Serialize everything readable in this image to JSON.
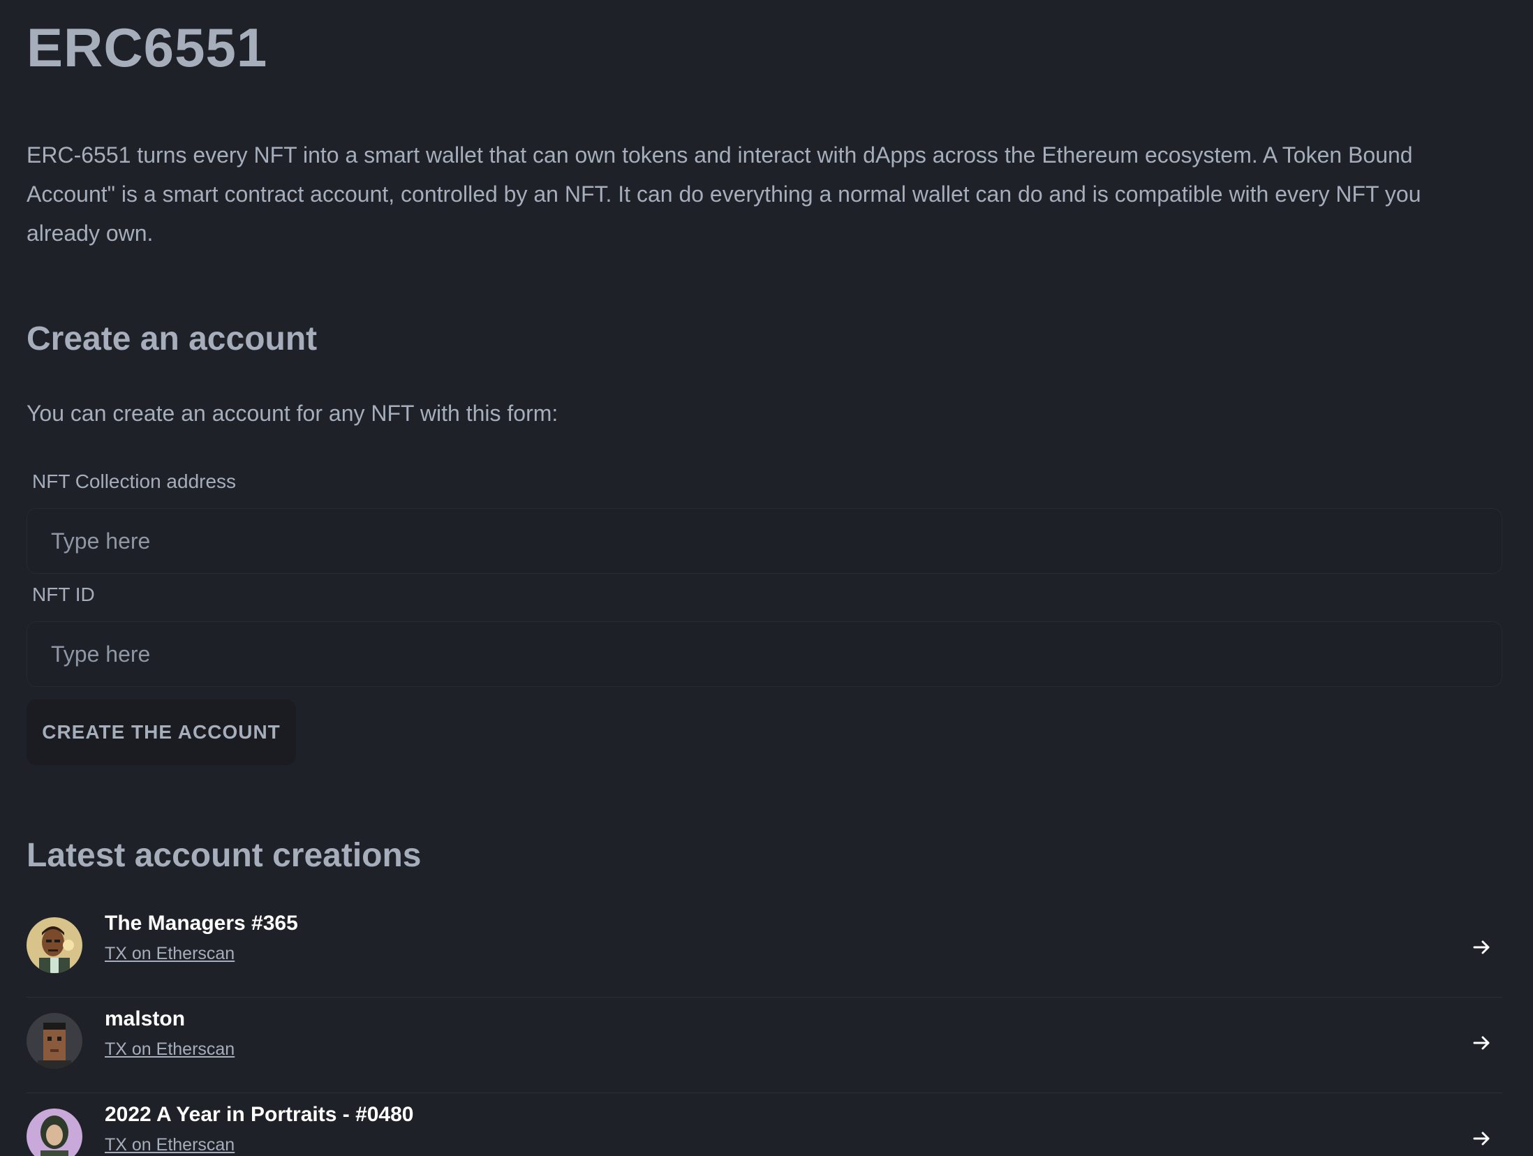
{
  "header": {
    "title": "ERC6551",
    "intro": "ERC-6551 turns every NFT into a smart wallet that can own tokens and interact with dApps across the Ethereum ecosystem. A Token Bound Account\" is a smart contract account, controlled by an NFT. It can do everything a normal wallet can do and is compatible with every NFT you already own."
  },
  "create": {
    "heading": "Create an account",
    "subtitle": "You can create an account for any NFT with this form:",
    "collection_label": "NFT Collection address",
    "collection_placeholder": "Type here",
    "id_label": "NFT ID",
    "id_placeholder": "Type here",
    "button_label": "CREATE THE ACCOUNT"
  },
  "latest": {
    "heading": "Latest account creations",
    "items": [
      {
        "title": "The Managers #365",
        "link": "TX on Etherscan",
        "icon": "arrow-right-icon"
      },
      {
        "title": "malston",
        "link": "TX on Etherscan",
        "icon": "arrow-right-icon"
      },
      {
        "title": "2022 A Year in Portraits - #0480",
        "link": "TX on Etherscan",
        "icon": "arrow-right-icon"
      }
    ]
  },
  "colors": {
    "background": "#1e2127",
    "text": "#a6adbb",
    "input_bg": "#1d2026",
    "button_bg": "#1a1c21"
  }
}
